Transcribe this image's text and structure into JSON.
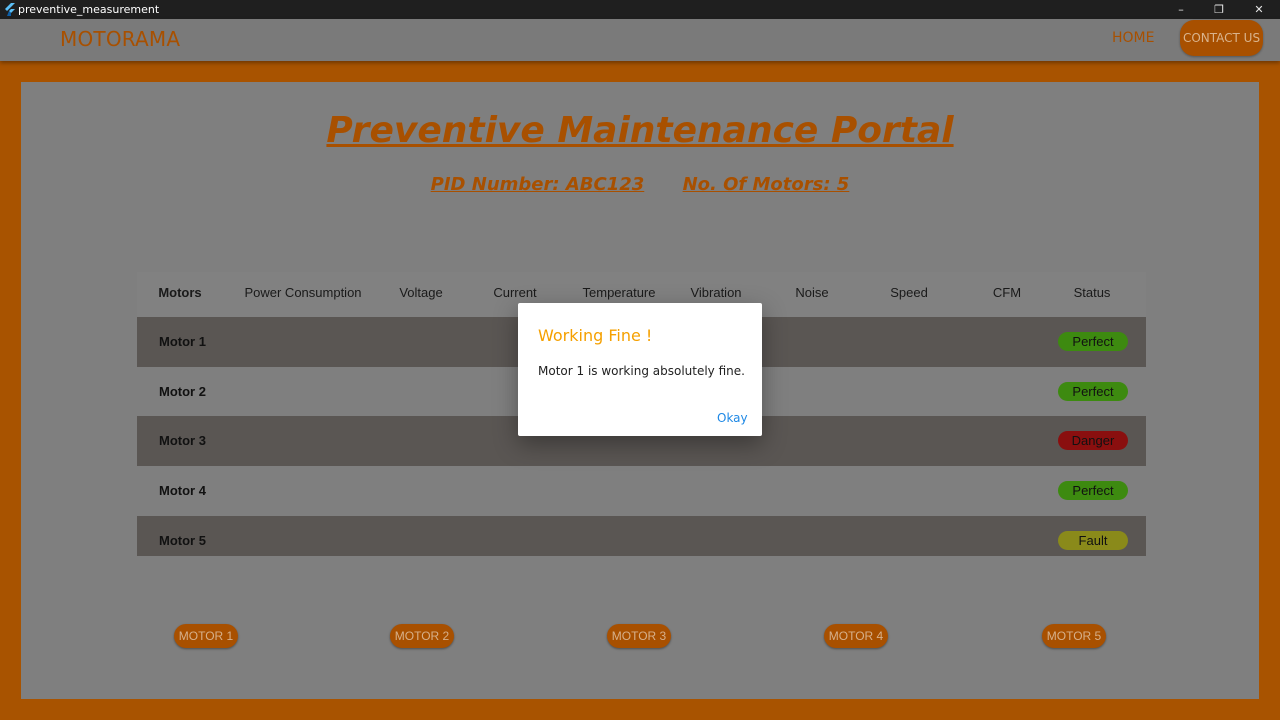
{
  "window": {
    "title": "preventive_measurement",
    "minimize": "–",
    "maximize": "❐",
    "close": "✕"
  },
  "appbar": {
    "brand": "MOTORAMA",
    "nav": {
      "home": "HOME",
      "contact": "CONTACT US"
    }
  },
  "page": {
    "title": "Preventive Maintenance Portal",
    "pid": "PID Number: ABC123",
    "motor_count": "No. Of Motors: 5"
  },
  "table": {
    "headers": [
      "Motors",
      "Power Consumption",
      "Voltage",
      "Current",
      "Temperature",
      "Vibration",
      "Noise",
      "Speed",
      "CFM",
      "Status"
    ],
    "rows": [
      {
        "name": "Motor 1",
        "status": "Perfect"
      },
      {
        "name": "Motor 2",
        "status": "Perfect"
      },
      {
        "name": "Motor 3",
        "status": "Danger"
      },
      {
        "name": "Motor 4",
        "status": "Perfect"
      },
      {
        "name": "Motor 5",
        "status": "Fault"
      }
    ]
  },
  "motor_buttons": [
    "MOTOR 1",
    "MOTOR 2",
    "MOTOR 3",
    "MOTOR 4",
    "MOTOR 5"
  ],
  "dialog": {
    "title": "Working Fine !",
    "message": "Motor 1 is working absolutely fine.",
    "ok_label": "Okay"
  },
  "colors": {
    "accent": "#f28c00",
    "status_perfect": "#7ed321",
    "status_danger": "#d0021b",
    "status_fault": "#e0e040",
    "link": "#1e88e5"
  }
}
